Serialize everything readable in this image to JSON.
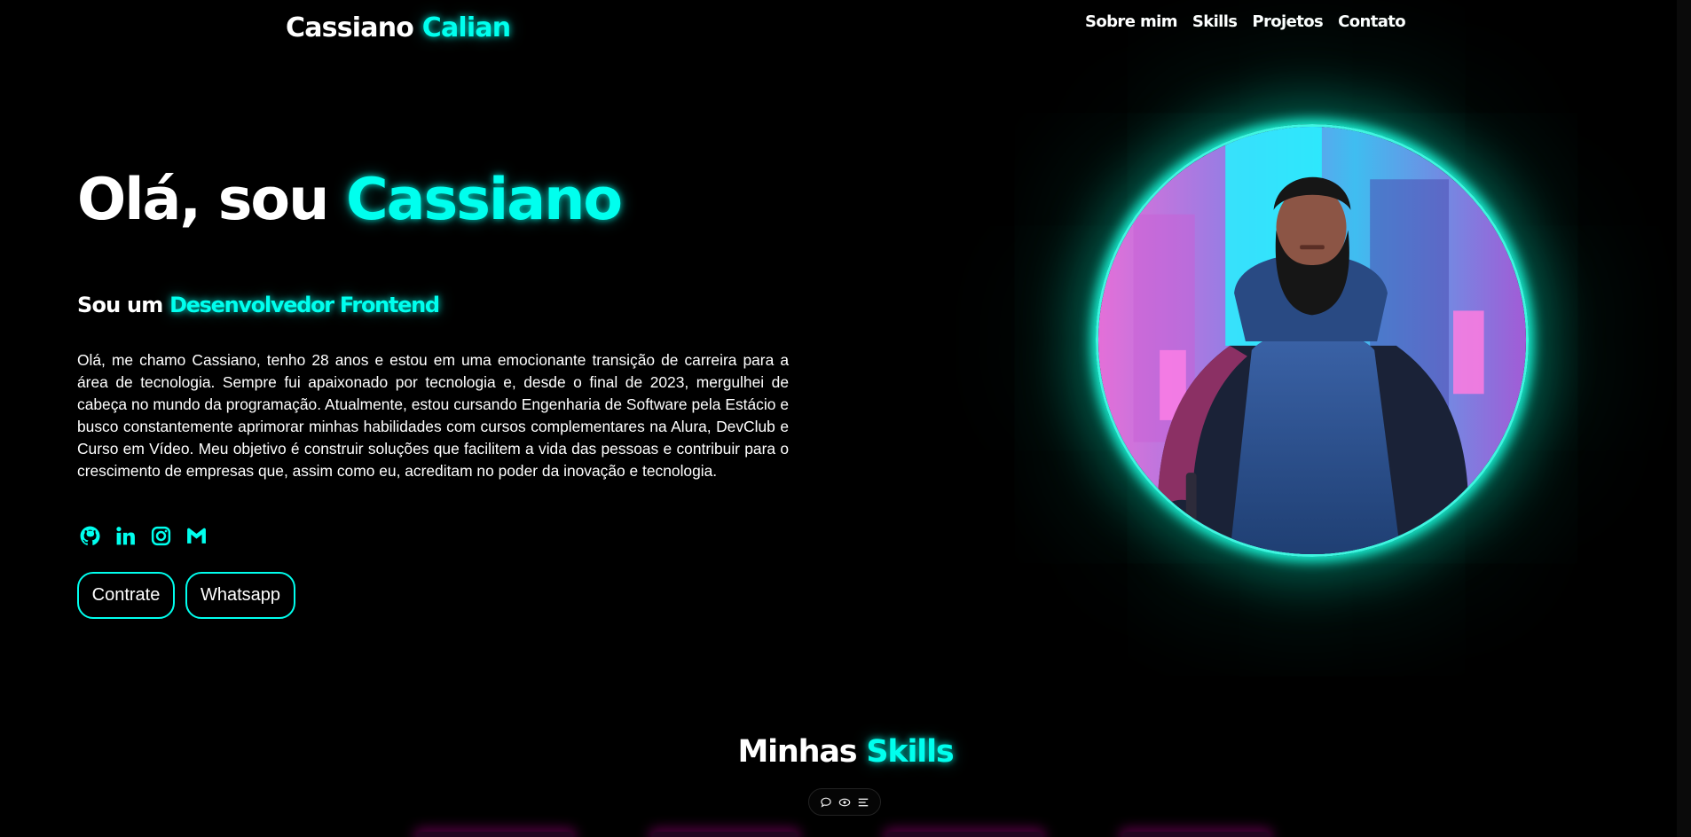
{
  "header": {
    "logo_first": "Cassiano",
    "logo_last": "Calian",
    "nav": [
      "Sobre mim",
      "Skills",
      "Projetos",
      "Contato"
    ]
  },
  "hero": {
    "title_prefix": "Olá, sou",
    "title_name": "Cassiano",
    "subtitle_prefix": "Sou um",
    "subtitle_role": "Desenvolvedor Frontend",
    "bio": "Olá, me chamo Cassiano, tenho 28 anos e estou em uma emocionante transição de carreira para a área de tecnologia. Sempre fui apaixonado por tecnologia e, desde o final de 2023, mergulhei de cabeça no mundo da programação. Atualmente, estou cursando Engenharia de Software pela Estácio e busco constantemente aprimorar minhas habilidades com cursos complementares na Alura, DevClub e Curso em Vídeo. Meu objetivo é construir soluções que facilitem a vida das pessoas e contribuir para o crescimento de empresas que, assim como eu, acreditam no poder da inovação e tecnologia.",
    "socials": [
      "github-icon",
      "linkedin-icon",
      "instagram-icon",
      "gmail-icon"
    ],
    "buttons": {
      "hire": "Contrate",
      "whatsapp": "Whatsapp"
    }
  },
  "skills": {
    "title_prefix": "Minhas",
    "title_highlight": "Skills",
    "filters": [
      "chat-icon",
      "eye-icon",
      "menu-icon"
    ]
  },
  "colors": {
    "accent": "#00ffee",
    "background": "#000000",
    "card_glow": "#ff00c8"
  }
}
